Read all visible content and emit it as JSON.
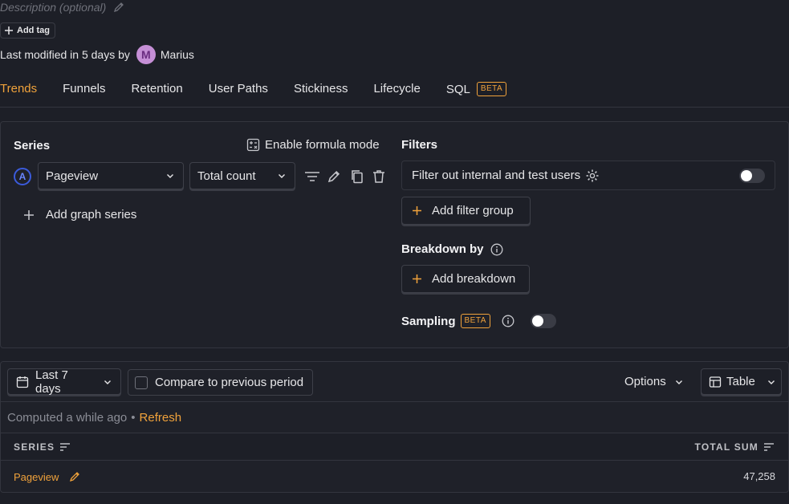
{
  "header": {
    "description_placeholder": "Description (optional)",
    "add_tag_label": "Add tag",
    "modified_text": "Last modified in 5 days by",
    "avatar_initial": "M",
    "modified_by": "Marius"
  },
  "tabs": [
    {
      "label": "Trends",
      "active": true
    },
    {
      "label": "Funnels"
    },
    {
      "label": "Retention"
    },
    {
      "label": "User Paths"
    },
    {
      "label": "Stickiness"
    },
    {
      "label": "Lifecycle"
    },
    {
      "label": "SQL",
      "badge": "BETA"
    }
  ],
  "series": {
    "title": "Series",
    "formula_label": "Enable formula mode",
    "items": [
      {
        "letter": "A",
        "event": "Pageview",
        "math": "Total count"
      }
    ],
    "add_label": "Add graph series"
  },
  "filters": {
    "title": "Filters",
    "internal_label": "Filter out internal and test users",
    "add_group_label": "Add filter group"
  },
  "breakdown": {
    "title": "Breakdown by",
    "add_label": "Add breakdown"
  },
  "sampling": {
    "title": "Sampling",
    "badge": "BETA"
  },
  "results": {
    "date_range": "Last 7 days",
    "compare_label": "Compare to previous period",
    "options_label": "Options",
    "display_label": "Table",
    "computed_text": "Computed a while ago",
    "separator": "•",
    "refresh_label": "Refresh",
    "columns": [
      "SERIES",
      "TOTAL SUM"
    ],
    "rows": [
      {
        "series": "Pageview",
        "total": "47,258"
      }
    ]
  },
  "colors": {
    "accent": "#f0a23b",
    "background": "#1d1f27",
    "series_a": "#3b5bdb"
  }
}
